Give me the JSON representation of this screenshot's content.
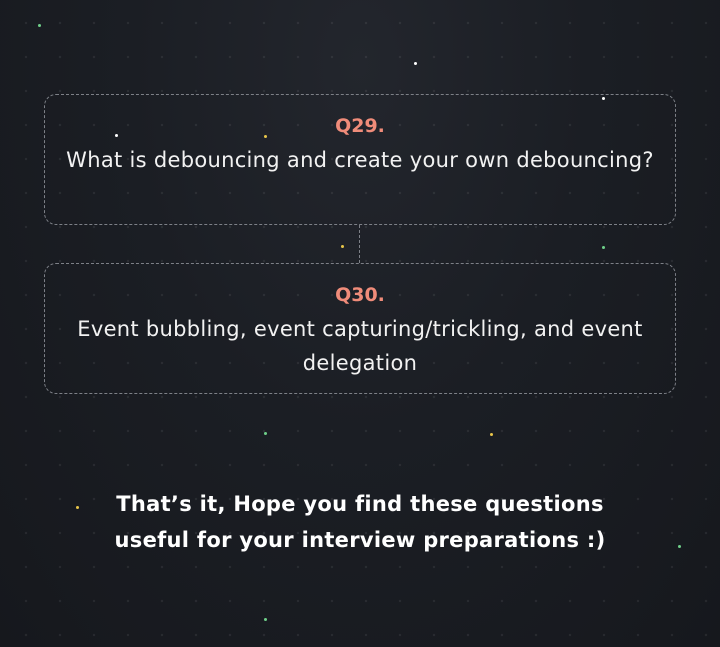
{
  "questions": [
    {
      "number": "Q29.",
      "text": "What is debouncing and create your own debouncing?"
    },
    {
      "number": "Q30.",
      "text": "Event bubbling, event capturing/trickling, and event delegation"
    }
  ],
  "closing": {
    "text": "That’s it, Hope you find these questions useful for your interview preparations :)"
  },
  "colors": {
    "background": "#1b1e24",
    "question_number": "#f08c7a",
    "question_text": "#f2f2f2",
    "border": "#7d8087",
    "spark_yellow": "#e8c54a",
    "spark_green": "#6fd08a",
    "spark_white": "#ffffff"
  }
}
